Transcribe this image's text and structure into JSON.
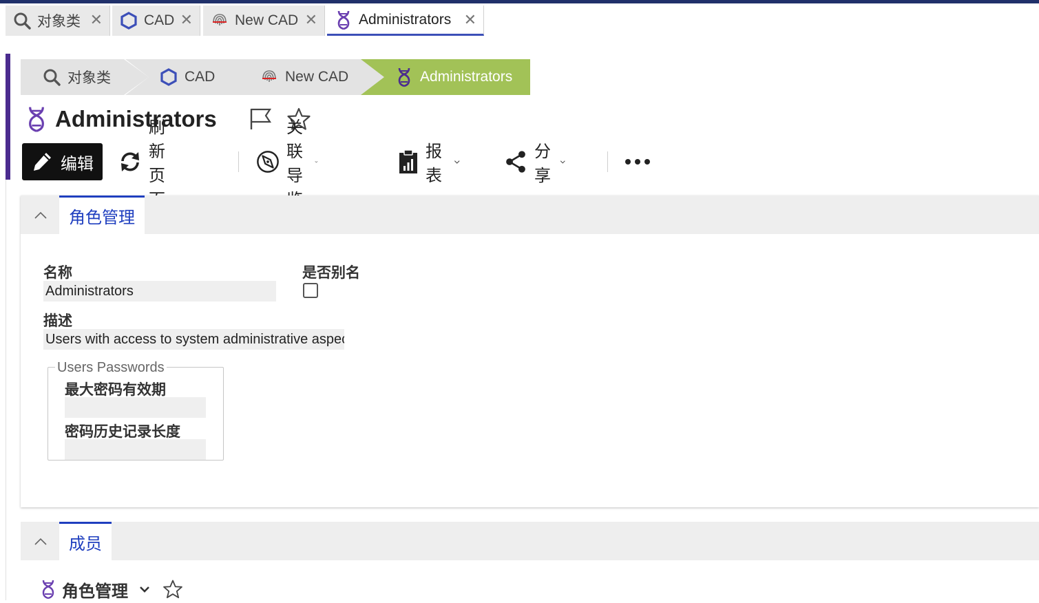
{
  "tabs": [
    {
      "label": "对象类",
      "icon": "search-icon"
    },
    {
      "label": "CAD",
      "icon": "hexagon-icon"
    },
    {
      "label": "New CAD",
      "icon": "fingerprint-icon"
    },
    {
      "label": "Administrators",
      "icon": "dna-icon"
    }
  ],
  "breadcrumb": [
    {
      "label": "对象类",
      "icon": "search-icon"
    },
    {
      "label": "CAD",
      "icon": "hexagon-icon"
    },
    {
      "label": "New CAD",
      "icon": "fingerprint-icon"
    },
    {
      "label": "Administrators",
      "icon": "dna-icon"
    }
  ],
  "page": {
    "title": "Administrators"
  },
  "toolbar": {
    "edit": "编辑",
    "refresh": "刷新页面",
    "related": "关联导览",
    "reports": "报表",
    "share": "分享"
  },
  "role_panel": {
    "tab": "角色管理",
    "name_label": "名称",
    "name_value": "Administrators",
    "alias_label": "是否别名",
    "alias_checked": false,
    "desc_label": "描述",
    "desc_value": "Users with access to system administrative aspects",
    "passwords_group": "Users Passwords",
    "max_age_label": "最大密码有效期",
    "max_age_value": "",
    "history_label": "密码历史记录长度",
    "history_value": ""
  },
  "members_panel": {
    "tab": "成员",
    "sub_title": "角色管理"
  },
  "colors": {
    "active_crumb": "#a2c257",
    "accent_blue": "#1f3fbf",
    "brand_purple": "#4b2c8f"
  }
}
